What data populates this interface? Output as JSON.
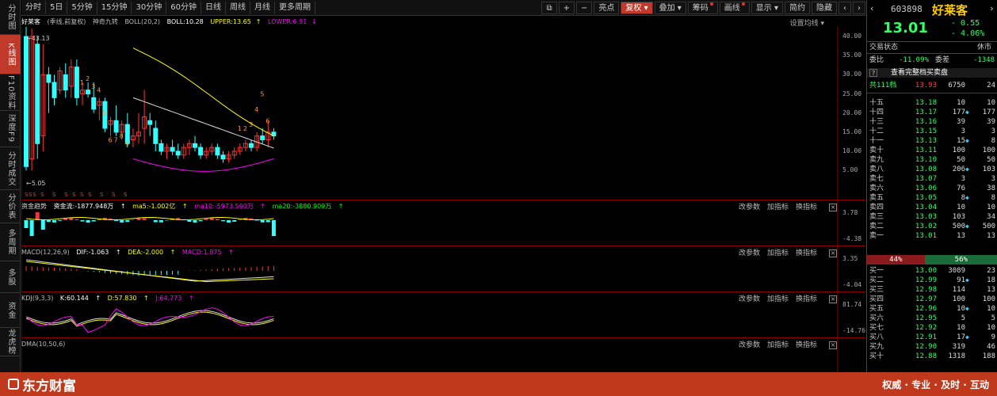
{
  "left_tabs": [
    {
      "label": "分时图",
      "h": 44
    },
    {
      "label": "K线图",
      "h": 50,
      "active": true
    },
    {
      "label": "F10资料",
      "h": 46
    },
    {
      "label": "深度F9",
      "h": 46
    },
    {
      "label": "分时成交",
      "h": 54
    },
    {
      "label": "分价表",
      "h": 42
    },
    {
      "label": "多周期",
      "h": 48
    },
    {
      "label": "多股",
      "h": 40
    },
    {
      "label": "资金",
      "h": 44
    },
    {
      "label": "龙虎榜",
      "h": 36
    }
  ],
  "toolbar": {
    "periods": [
      "分时",
      "5日",
      "5分钟",
      "15分钟",
      "30分钟",
      "60分钟",
      "日线",
      "周线",
      "月线",
      "更多周期"
    ],
    "right": [
      "亮点",
      "复权",
      "叠加",
      "筹码",
      "画线",
      "显示",
      "简约",
      "隐藏"
    ]
  },
  "main": {
    "stock": "好莱客",
    "mode": "(季线,前复权)",
    "ind1": "神奇九转",
    "boll": "BOLL(20,2)",
    "mid": "BOLL:10.28",
    "upper": "UPPER:13.65",
    "lower": "LOWER:6.91",
    "settings": "设置均线",
    "high_label": "43.13",
    "low_label": "5.05",
    "y_labels": [
      "40.00",
      "35.00",
      "30.00",
      "25.00",
      "20.00",
      "15.00",
      "10.00",
      "5.00"
    ]
  },
  "fund": {
    "name": "资金趋势",
    "v1": "资金流:-1877.948万",
    "v2": "ma5:-1.002亿",
    "v3": "ma10:-5973.590万",
    "v4": "ma20:-3880.909万",
    "y_top": "3.78",
    "y_bot": "-4.38"
  },
  "macd": {
    "name": "MACD(12,26,9)",
    "dif": "DIF:-1.063",
    "dea": "DEA:-2.000",
    "macd": "MACD:1.875",
    "y_top": "3.35",
    "y_bot": "-4.04"
  },
  "kdj": {
    "name": "KDJ(9,3,3)",
    "k": "K:60.144",
    "d": "D:57.830",
    "j": "J:64.773",
    "y_top": "81.74",
    "y_bot": "-14.76"
  },
  "dma": {
    "name": "DMA(10,50,6)"
  },
  "panel_btns": [
    "改参数",
    "加指标",
    "换指标"
  ],
  "quote": {
    "code": "603898",
    "name": "好莱客",
    "price": "13.01",
    "chg": "- 0.55",
    "pct": "- 4.06%",
    "status_label": "交易状态",
    "status": "休市",
    "wb_label": "委比",
    "wb": "-11.09%",
    "wc_label": "委差",
    "wc": "-1348",
    "full_book": "查看完整档买卖盘",
    "tot_label": "共111档",
    "tot_p": "13.93",
    "tot_v": "6750",
    "tot_n": "24",
    "buy_pct": "44%",
    "sell_pct": "56%"
  },
  "asks": [
    [
      "十五",
      "13.18",
      "10",
      "10"
    ],
    [
      "十四",
      "13.17",
      "177",
      "177"
    ],
    [
      "十三",
      "13.16",
      "39",
      "39"
    ],
    [
      "十二",
      "13.15",
      "3",
      "3"
    ],
    [
      "十一",
      "13.13",
      "15",
      "8"
    ],
    [
      "卖十",
      "13.11",
      "100",
      "100"
    ],
    [
      "卖九",
      "13.10",
      "50",
      "50"
    ],
    [
      "卖八",
      "13.08",
      "206",
      "103"
    ],
    [
      "卖七",
      "13.07",
      "3",
      "3"
    ],
    [
      "卖六",
      "13.06",
      "76",
      "38"
    ],
    [
      "卖五",
      "13.05",
      "8",
      "8"
    ],
    [
      "卖四",
      "13.04",
      "10",
      "10"
    ],
    [
      "卖三",
      "13.03",
      "103",
      "34"
    ],
    [
      "卖二",
      "13.02",
      "500",
      "500"
    ],
    [
      "卖一",
      "13.01",
      "13",
      "13"
    ]
  ],
  "bids": [
    [
      "买一",
      "13.00",
      "3089",
      "23"
    ],
    [
      "买二",
      "12.99",
      "91",
      "18"
    ],
    [
      "买三",
      "12.98",
      "114",
      "13"
    ],
    [
      "买四",
      "12.97",
      "100",
      "100"
    ],
    [
      "买五",
      "12.96",
      "10",
      "10"
    ],
    [
      "买六",
      "12.95",
      "5",
      "5"
    ],
    [
      "买七",
      "12.92",
      "10",
      "10"
    ],
    [
      "买八",
      "12.91",
      "17",
      "9"
    ],
    [
      "买九",
      "12.90",
      "319",
      "46"
    ],
    [
      "买十",
      "12.88",
      "1318",
      "188"
    ]
  ],
  "footer": {
    "logo": "东方财富",
    "slogan": "权威 · 专业 · 及时 · 互动"
  },
  "colors": {
    "up": "#ff3333",
    "down": "#33ffff",
    "yellow": "#ffff00",
    "magenta": "#ff00ff",
    "white": "#ffffff",
    "accent": "#c0392b"
  }
}
